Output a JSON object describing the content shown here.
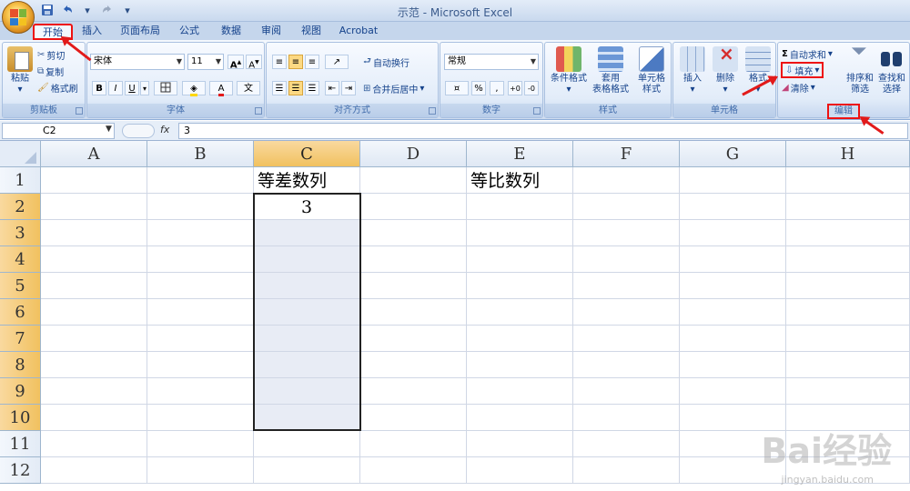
{
  "window": {
    "title": "示范 - Microsoft Excel"
  },
  "qat": {
    "save_icon": "save-icon",
    "undo_icon": "undo-icon",
    "redo_icon": "redo-icon"
  },
  "tabs": [
    {
      "label": "开始"
    },
    {
      "label": "插入"
    },
    {
      "label": "页面布局"
    },
    {
      "label": "公式"
    },
    {
      "label": "数据"
    },
    {
      "label": "审阅"
    },
    {
      "label": "视图"
    },
    {
      "label": "Acrobat"
    }
  ],
  "ribbon": {
    "clipboard": {
      "paste": "粘贴",
      "cut": "剪切",
      "copy": "复制",
      "format_painter": "格式刷",
      "label": "剪贴板"
    },
    "font": {
      "name": "宋体",
      "size": "11",
      "bold": "B",
      "italic": "I",
      "underline": "U",
      "label": "字体"
    },
    "alignment": {
      "wrap": "自动换行",
      "merge": "合并后居中",
      "label": "对齐方式"
    },
    "number": {
      "format": "常规",
      "percent": "%",
      "comma": ",",
      "label": "数字"
    },
    "styles": {
      "conditional": "条件格式",
      "table_line1": "套用",
      "table_line2": "表格格式",
      "cell_line1": "单元格",
      "cell_line2": "样式",
      "label": "样式"
    },
    "cells": {
      "insert": "插入",
      "delete": "删除",
      "format": "格式",
      "label": "单元格"
    },
    "editing": {
      "autosum": "自动求和",
      "fill": "填充",
      "clear": "清除",
      "sort_line1": "排序和",
      "sort_line2": "筛选",
      "find_line1": "查找和",
      "find_line2": "选择",
      "label": "编辑"
    }
  },
  "formula_bar": {
    "name_box": "C2",
    "fx": "fx",
    "value": "3"
  },
  "grid": {
    "columns": [
      "A",
      "B",
      "C",
      "D",
      "E",
      "F",
      "G",
      "H"
    ],
    "rows": [
      "1",
      "2",
      "3",
      "4",
      "5",
      "6",
      "7",
      "8",
      "9",
      "10",
      "11",
      "12"
    ],
    "cells": {
      "C1": "等差数列",
      "E1": "等比数列",
      "C2": "3"
    }
  },
  "watermark": {
    "main": "Bai经验",
    "sub": "jingyan.baidu.com"
  }
}
